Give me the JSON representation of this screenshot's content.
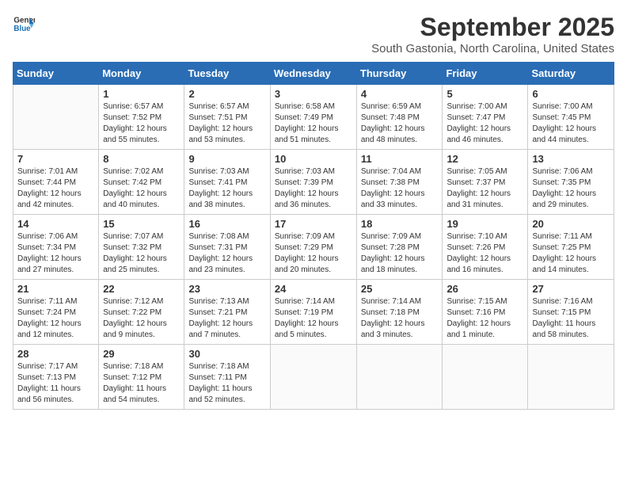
{
  "logo": {
    "text_general": "General",
    "text_blue": "Blue"
  },
  "title": "September 2025",
  "location": "South Gastonia, North Carolina, United States",
  "headers": [
    "Sunday",
    "Monday",
    "Tuesday",
    "Wednesday",
    "Thursday",
    "Friday",
    "Saturday"
  ],
  "weeks": [
    [
      {
        "day": "",
        "info": ""
      },
      {
        "day": "1",
        "info": "Sunrise: 6:57 AM\nSunset: 7:52 PM\nDaylight: 12 hours\nand 55 minutes."
      },
      {
        "day": "2",
        "info": "Sunrise: 6:57 AM\nSunset: 7:51 PM\nDaylight: 12 hours\nand 53 minutes."
      },
      {
        "day": "3",
        "info": "Sunrise: 6:58 AM\nSunset: 7:49 PM\nDaylight: 12 hours\nand 51 minutes."
      },
      {
        "day": "4",
        "info": "Sunrise: 6:59 AM\nSunset: 7:48 PM\nDaylight: 12 hours\nand 48 minutes."
      },
      {
        "day": "5",
        "info": "Sunrise: 7:00 AM\nSunset: 7:47 PM\nDaylight: 12 hours\nand 46 minutes."
      },
      {
        "day": "6",
        "info": "Sunrise: 7:00 AM\nSunset: 7:45 PM\nDaylight: 12 hours\nand 44 minutes."
      }
    ],
    [
      {
        "day": "7",
        "info": "Sunrise: 7:01 AM\nSunset: 7:44 PM\nDaylight: 12 hours\nand 42 minutes."
      },
      {
        "day": "8",
        "info": "Sunrise: 7:02 AM\nSunset: 7:42 PM\nDaylight: 12 hours\nand 40 minutes."
      },
      {
        "day": "9",
        "info": "Sunrise: 7:03 AM\nSunset: 7:41 PM\nDaylight: 12 hours\nand 38 minutes."
      },
      {
        "day": "10",
        "info": "Sunrise: 7:03 AM\nSunset: 7:39 PM\nDaylight: 12 hours\nand 36 minutes."
      },
      {
        "day": "11",
        "info": "Sunrise: 7:04 AM\nSunset: 7:38 PM\nDaylight: 12 hours\nand 33 minutes."
      },
      {
        "day": "12",
        "info": "Sunrise: 7:05 AM\nSunset: 7:37 PM\nDaylight: 12 hours\nand 31 minutes."
      },
      {
        "day": "13",
        "info": "Sunrise: 7:06 AM\nSunset: 7:35 PM\nDaylight: 12 hours\nand 29 minutes."
      }
    ],
    [
      {
        "day": "14",
        "info": "Sunrise: 7:06 AM\nSunset: 7:34 PM\nDaylight: 12 hours\nand 27 minutes."
      },
      {
        "day": "15",
        "info": "Sunrise: 7:07 AM\nSunset: 7:32 PM\nDaylight: 12 hours\nand 25 minutes."
      },
      {
        "day": "16",
        "info": "Sunrise: 7:08 AM\nSunset: 7:31 PM\nDaylight: 12 hours\nand 23 minutes."
      },
      {
        "day": "17",
        "info": "Sunrise: 7:09 AM\nSunset: 7:29 PM\nDaylight: 12 hours\nand 20 minutes."
      },
      {
        "day": "18",
        "info": "Sunrise: 7:09 AM\nSunset: 7:28 PM\nDaylight: 12 hours\nand 18 minutes."
      },
      {
        "day": "19",
        "info": "Sunrise: 7:10 AM\nSunset: 7:26 PM\nDaylight: 12 hours\nand 16 minutes."
      },
      {
        "day": "20",
        "info": "Sunrise: 7:11 AM\nSunset: 7:25 PM\nDaylight: 12 hours\nand 14 minutes."
      }
    ],
    [
      {
        "day": "21",
        "info": "Sunrise: 7:11 AM\nSunset: 7:24 PM\nDaylight: 12 hours\nand 12 minutes."
      },
      {
        "day": "22",
        "info": "Sunrise: 7:12 AM\nSunset: 7:22 PM\nDaylight: 12 hours\nand 9 minutes."
      },
      {
        "day": "23",
        "info": "Sunrise: 7:13 AM\nSunset: 7:21 PM\nDaylight: 12 hours\nand 7 minutes."
      },
      {
        "day": "24",
        "info": "Sunrise: 7:14 AM\nSunset: 7:19 PM\nDaylight: 12 hours\nand 5 minutes."
      },
      {
        "day": "25",
        "info": "Sunrise: 7:14 AM\nSunset: 7:18 PM\nDaylight: 12 hours\nand 3 minutes."
      },
      {
        "day": "26",
        "info": "Sunrise: 7:15 AM\nSunset: 7:16 PM\nDaylight: 12 hours\nand 1 minute."
      },
      {
        "day": "27",
        "info": "Sunrise: 7:16 AM\nSunset: 7:15 PM\nDaylight: 11 hours\nand 58 minutes."
      }
    ],
    [
      {
        "day": "28",
        "info": "Sunrise: 7:17 AM\nSunset: 7:13 PM\nDaylight: 11 hours\nand 56 minutes."
      },
      {
        "day": "29",
        "info": "Sunrise: 7:18 AM\nSunset: 7:12 PM\nDaylight: 11 hours\nand 54 minutes."
      },
      {
        "day": "30",
        "info": "Sunrise: 7:18 AM\nSunset: 7:11 PM\nDaylight: 11 hours\nand 52 minutes."
      },
      {
        "day": "",
        "info": ""
      },
      {
        "day": "",
        "info": ""
      },
      {
        "day": "",
        "info": ""
      },
      {
        "day": "",
        "info": ""
      }
    ]
  ]
}
